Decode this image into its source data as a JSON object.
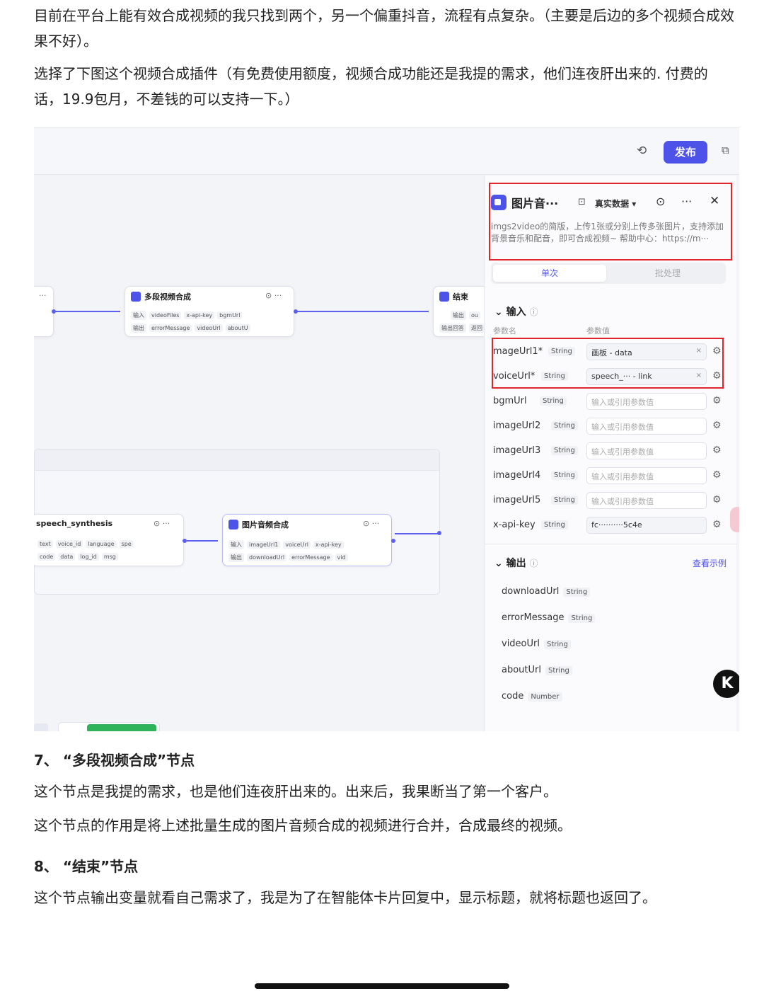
{
  "article": {
    "p1": "目前在平台上能有效合成视频的我只找到两个，另一个偏重抖音，流程有点复杂。（主要是后边的多个视频合成效果不好）。",
    "p2": "选择了下图这个视频合成插件（有免费使用额度，视频合成功能还是我提的需求，他们连夜肝出来的. 付费的话，19.9包月，不差钱的可以支持一下。）",
    "h7": "7、 “多段视频合成”节点",
    "p3": "这个节点是我提的需求，也是他们连夜肝出来的。出来后，我果断当了第一个客户。",
    "p4": "这个节点的作用是将上述批量生成的图片音频合成的视频进行合并，合成最终的视频。",
    "h8": "8、 “结束”节点",
    "p5": "这个节点输出变量就看自己需求了，我是为了在智能体卡片回复中，显示标题，就将标题也返回了。"
  },
  "topbar": {
    "publish_label": "发布",
    "history_icon": "history-icon",
    "copy_icon": "copy-icon"
  },
  "canvas": {
    "node_multi": {
      "title": "多段视频合成",
      "in_label": "输入",
      "out_label": "输出",
      "inputs": [
        "videoFiles",
        "x-api-key",
        "bgmUrl"
      ],
      "outputs": [
        "errorMessage",
        "videoUrl",
        "aboutU"
      ]
    },
    "node_end": {
      "title": "结束",
      "out_label": "输出",
      "out_value": "ou",
      "answer_label": "输出回答",
      "answer_value": "返回"
    },
    "node_speech": {
      "title": "speech_synthesis",
      "inputs": [
        "text",
        "voice_id",
        "language",
        "spe"
      ],
      "outputs": [
        "code",
        "data",
        "log_id",
        "msg"
      ]
    },
    "node_img_audio": {
      "title": "图片音频合成",
      "in_label": "输入",
      "out_label": "输出",
      "inputs": [
        "imageUrl1",
        "voiceUrl",
        "x-api-key"
      ],
      "outputs": [
        "downloadUrl",
        "errorMessage",
        "vid"
      ]
    }
  },
  "panel": {
    "title": "图片音···",
    "data_mode": "真实数据",
    "description": "imgs2video的简版，上传1张或分别上传多张图片，支持添加背景音乐和配音，即可合成视频~ 帮助中心：https://m···",
    "tab_single": "单次",
    "tab_batch": "批处理",
    "input_section": "输入",
    "col_name": "参数名",
    "col_value": "参数值",
    "placeholder": "输入或引用参数值",
    "params": [
      {
        "name": "mageUrl1*",
        "type": "String",
        "value": "画板 - data"
      },
      {
        "name": "voiceUrl*",
        "type": "String",
        "value": "speech_··· - link"
      },
      {
        "name": "bgmUrl",
        "type": "String",
        "value": ""
      },
      {
        "name": "imageUrl2",
        "type": "String",
        "value": ""
      },
      {
        "name": "imageUrl3",
        "type": "String",
        "value": ""
      },
      {
        "name": "imageUrl4",
        "type": "String",
        "value": ""
      },
      {
        "name": "imageUrl5",
        "type": "String",
        "value": ""
      },
      {
        "name": "x-api-key",
        "type": "String",
        "value": "fc··········5c4e"
      }
    ],
    "output_section": "输出",
    "view_example": "查看示例",
    "outputs": [
      {
        "name": "downloadUrl",
        "type": "String"
      },
      {
        "name": "errorMessage",
        "type": "String"
      },
      {
        "name": "videoUrl",
        "type": "String"
      },
      {
        "name": "aboutUrl",
        "type": "String"
      },
      {
        "name": "code",
        "type": "Number"
      }
    ]
  },
  "badge": {
    "letter": "K"
  }
}
